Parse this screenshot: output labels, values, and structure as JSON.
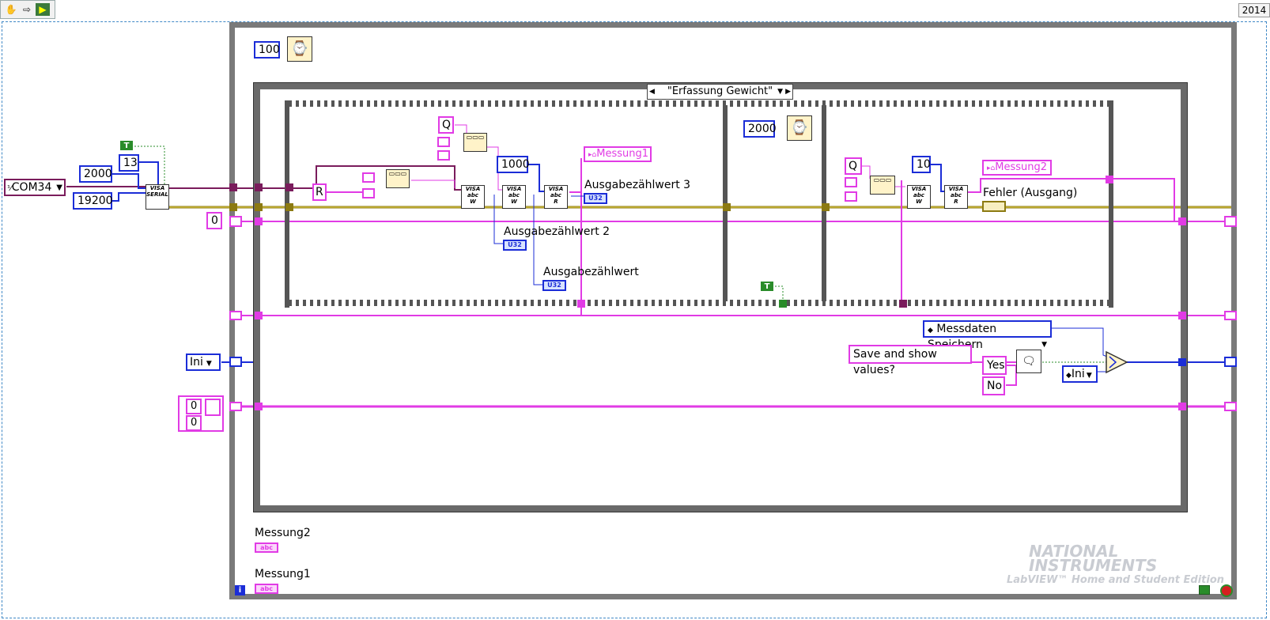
{
  "toolbar": {
    "run_icon": "hand-icon",
    "step_icon": "arrow-icon",
    "probe_icon": "labview-icon",
    "version": "2014"
  },
  "controls": {
    "com_port": "COM34",
    "timeout": "2000",
    "baud": "19200",
    "data_bits": "13",
    "true_const": "T",
    "shift_init": "0",
    "enum_ini": "Ini",
    "array_val_0": "0",
    "array_val_1": "0",
    "visa_serial": "VISA SERIAL"
  },
  "while_loop": {
    "wait_ms": "100",
    "info_icon": "i"
  },
  "case_structure": {
    "selector": "\"Erfassung Gewicht\""
  },
  "frame1": {
    "const_q": "Q",
    "const_r": "R",
    "const_1000": "1000",
    "local_messung1": "Messung1",
    "label_ausgabe3": "Ausgabezählwert 3",
    "label_ausgabe2": "Ausgabezählwert 2",
    "label_ausgabe": "Ausgabezählwert",
    "u32": "U32"
  },
  "frame2": {
    "wait_ms": "2000",
    "true_const": "T"
  },
  "frame3": {
    "const_q": "Q",
    "const_10": "10",
    "local_messung2": "Messung2",
    "label_fehler": "Fehler (Ausgang)"
  },
  "lower": {
    "enum_messdaten": "Messdaten Speichern",
    "dialog_msg": "Save and show values?",
    "yes": "Yes",
    "no": "No",
    "enum_ini": "Ini"
  },
  "indicators": {
    "messung2": "Messung2",
    "messung1": "Messung1",
    "abc": "abc"
  },
  "watermark": {
    "brand_top": "NATIONAL",
    "brand_bottom": "INSTRUMENTS",
    "edition": "LabVIEW™ Home and Student Edition"
  },
  "colors": {
    "wire_string": "#e13be5",
    "wire_int": "#1b2dd7",
    "wire_error": "#8c7a12",
    "wire_visa": "#7a1c5c",
    "wire_bool": "#2a8c2a"
  }
}
